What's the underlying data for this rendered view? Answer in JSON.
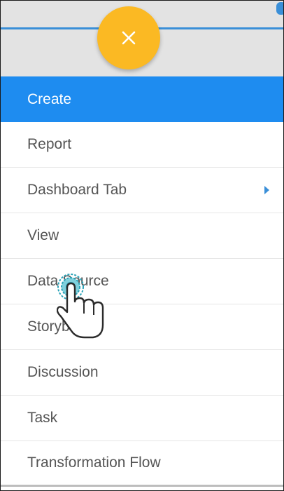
{
  "header": {
    "close_icon": "close-icon",
    "accent_color": "#fbb923",
    "line_color": "#3a8fd8"
  },
  "menu": {
    "items": [
      {
        "label": "Create",
        "active": true
      },
      {
        "label": "Report"
      },
      {
        "label": "Dashboard Tab",
        "has_submenu": true
      },
      {
        "label": "View"
      },
      {
        "label": "Data Source"
      },
      {
        "label": "Storyboard"
      },
      {
        "label": "Discussion"
      },
      {
        "label": "Task"
      },
      {
        "label": "Transformation Flow"
      }
    ],
    "active_color": "#1e8cf0"
  },
  "cursor": {
    "icon": "hand-pointer-icon"
  }
}
